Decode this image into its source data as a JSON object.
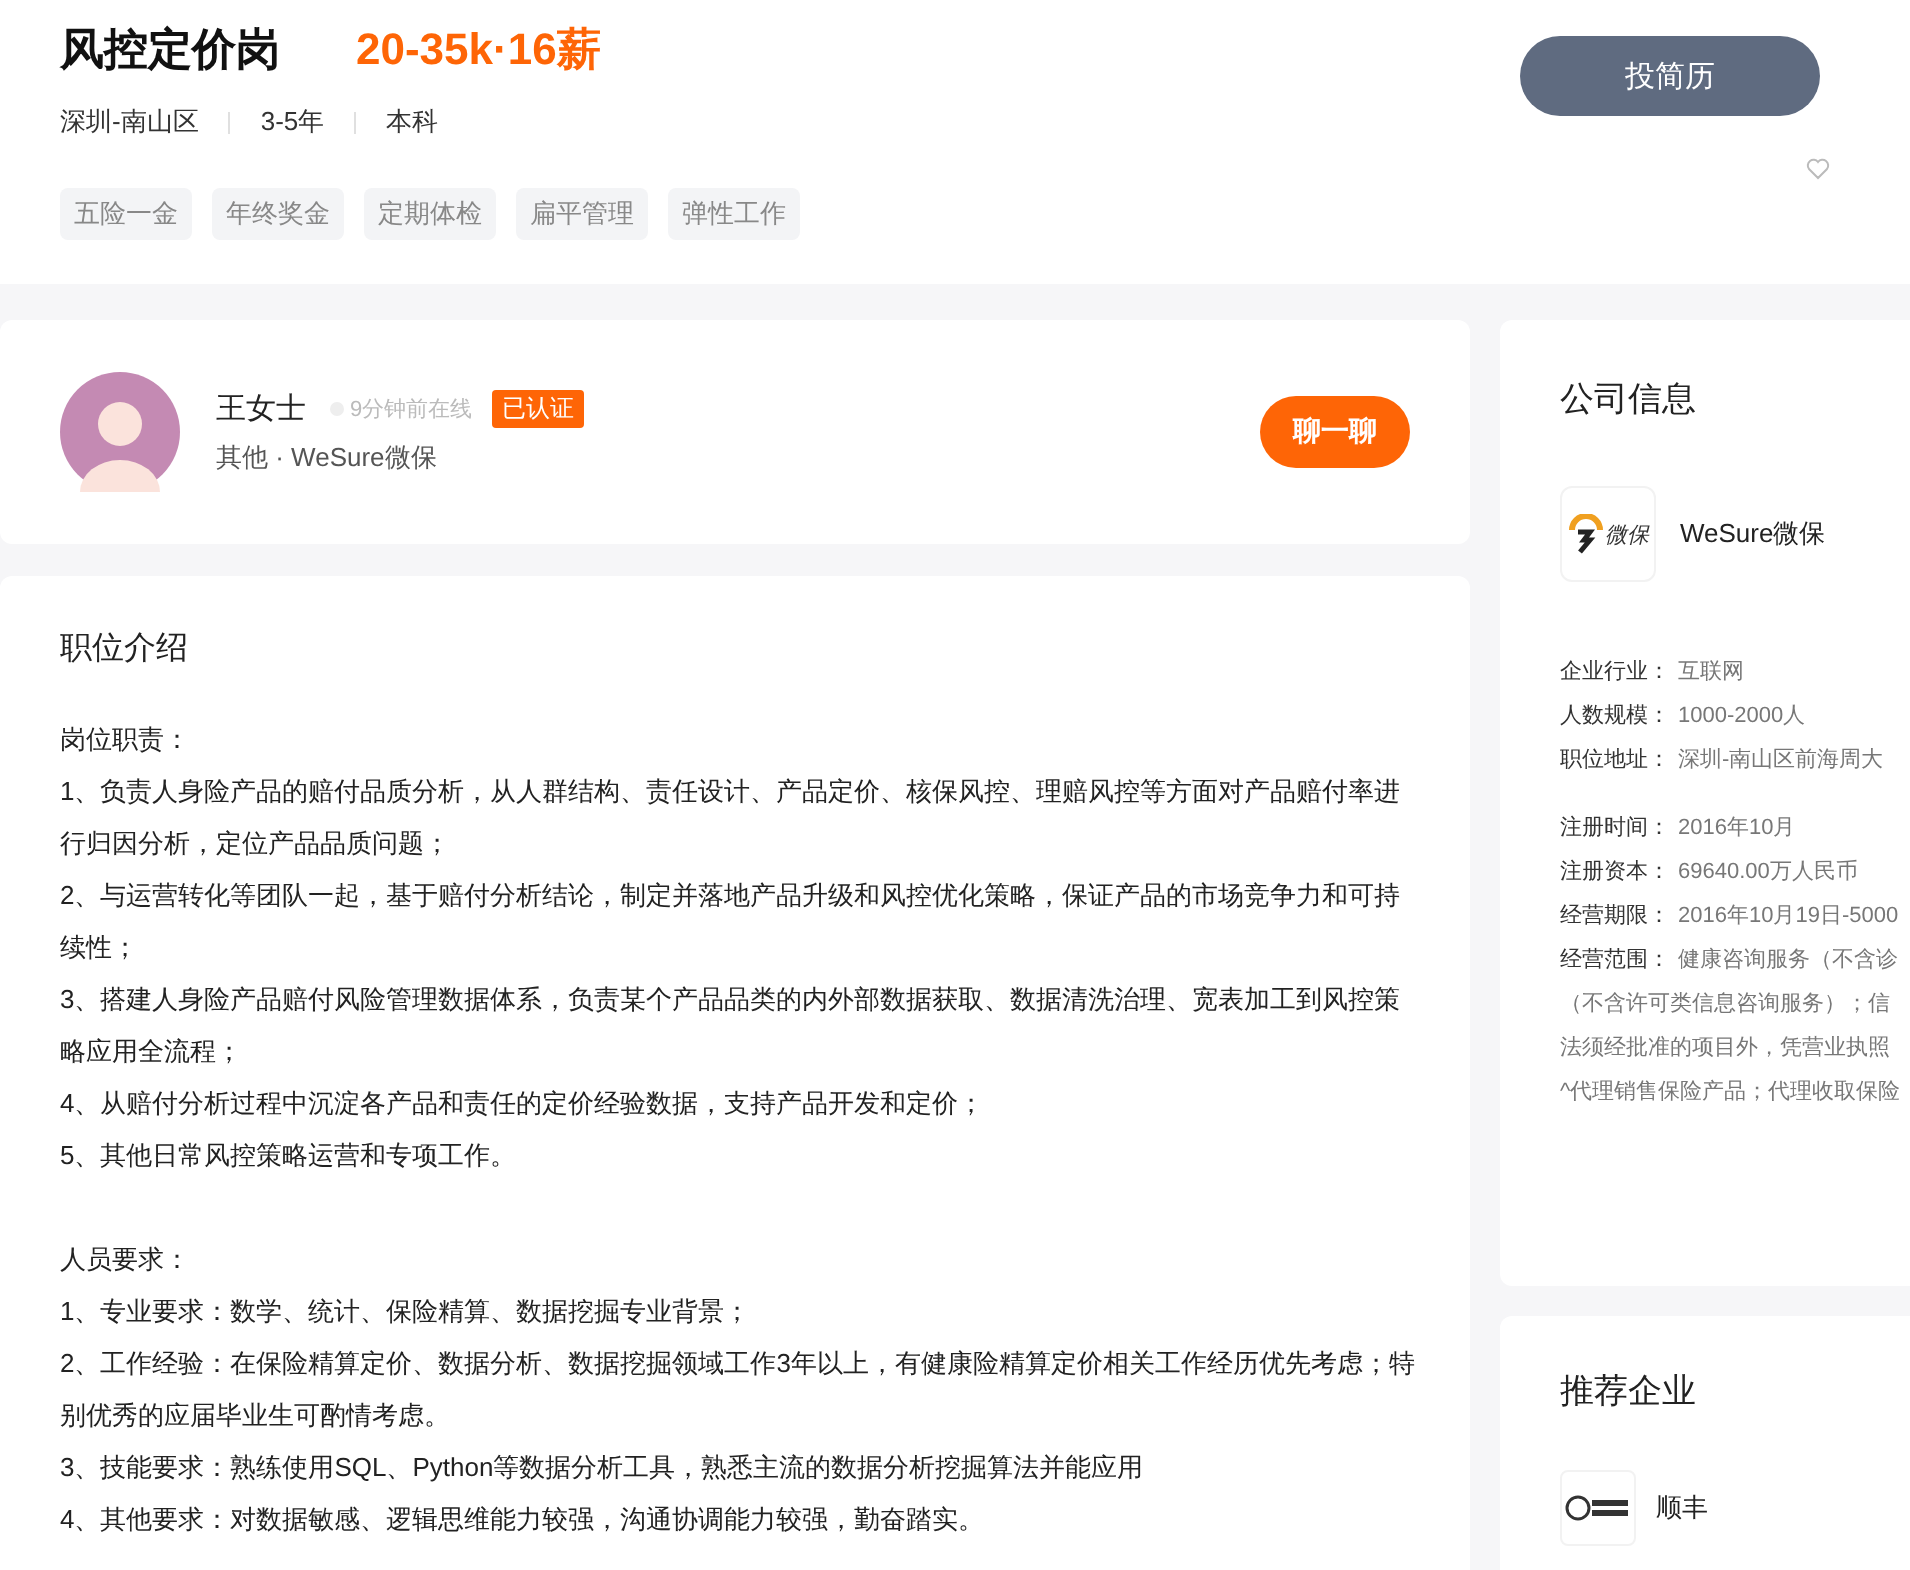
{
  "job": {
    "title": "风控定价岗",
    "salary": "20-35k·16薪",
    "meta": [
      "深圳-南山区",
      "3-5年",
      "本科"
    ],
    "tags": [
      "五险一金",
      "年终奖金",
      "定期体检",
      "扁平管理",
      "弹性工作"
    ],
    "apply_button": "投简历"
  },
  "recruiter": {
    "name": "王女士",
    "online_status": "9分钟前在线",
    "badge": "已认证",
    "company_line": "其他 · WeSure微保",
    "chat_button": "聊一聊"
  },
  "description": {
    "title": "职位介绍",
    "sections": [
      {
        "heading": "岗位职责：",
        "lines": [
          "1、负责人身险产品的赔付品质分析，从人群结构、责任设计、产品定价、核保风控、理赔风控等方面对产品赔付率进行归因分析，定位产品品质问题；",
          "2、与运营转化等团队一起，基于赔付分析结论，制定并落地产品升级和风控优化策略，保证产品的市场竞争力和可持续性；",
          "3、搭建人身险产品赔付风险管理数据体系，负责某个产品品类的内外部数据获取、数据清洗治理、宽表加工到风控策略应用全流程；",
          "4、从赔付分析过程中沉淀各产品和责任的定价经验数据，支持产品开发和定价；",
          "5、其他日常风控策略运营和专项工作。"
        ]
      },
      {
        "heading": "人员要求：",
        "lines": [
          "1、专业要求：数学、统计、保险精算、数据挖掘专业背景；",
          "2、工作经验：在保险精算定价、数据分析、数据挖掘领域工作3年以上，有健康险精算定价相关工作经历优先考虑；特别优秀的应届毕业生可酌情考虑。",
          "3、技能要求：熟练使用SQL、Python等数据分析工具，熟悉主流的数据分析挖掘算法并能应用",
          "4、其他要求：对数据敏感、逻辑思维能力较强，沟通协调能力较强，勤奋踏实。"
        ]
      }
    ]
  },
  "company": {
    "title": "公司信息",
    "logo_text": "微保",
    "name": "WeSure微保",
    "groups": [
      [
        {
          "label": "企业行业：",
          "value": "互联网"
        },
        {
          "label": "人数规模：",
          "value": "1000-2000人"
        },
        {
          "label": "职位地址：",
          "value": "深圳-南山区前海周大"
        }
      ],
      [
        {
          "label": "注册时间：",
          "value": "2016年10月"
        },
        {
          "label": "注册资本：",
          "value": "69640.00万人民币"
        },
        {
          "label": "经营期限：",
          "value": "2016年10月19日-5000"
        },
        {
          "label": "经营范围：",
          "value": "健康咨询服务（不含诊"
        }
      ]
    ],
    "scope_lines": [
      "（不含许可类信息咨询服务）；信",
      "法须经批准的项目外，凭营业执照",
      "^代理销售保险产品；代理收取保险"
    ]
  },
  "recommended": {
    "title": "推荐企业",
    "companies": [
      {
        "name": "顺丰"
      }
    ]
  }
}
